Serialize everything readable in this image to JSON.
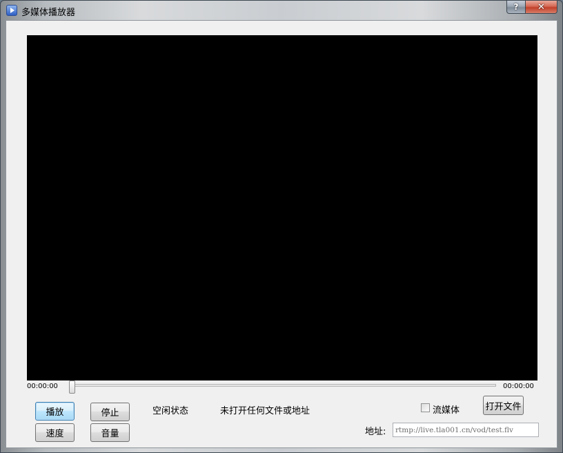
{
  "window": {
    "title": "多媒体播放器",
    "help_label": "?",
    "close_label": "✕"
  },
  "player": {
    "time_current": "00:00:00",
    "time_total": "00:00:00",
    "progress": 0
  },
  "controls": {
    "play_label": "播放",
    "stop_label": "停止",
    "speed_label": "速度",
    "volume_label": "音量",
    "open_file_label": "打开文件"
  },
  "status": {
    "state": "空闲状态",
    "file": "未打开任何文件或地址"
  },
  "stream": {
    "checkbox_label": "流媒体",
    "checked": false
  },
  "address": {
    "label": "地址:",
    "placeholder": "rtmp://live.tla001.cn/vod/test.flv"
  },
  "colors": {
    "video_background": "#000000",
    "client_background": "#f0f0f0",
    "close_button": "#c2402a",
    "default_button_border": "#3c7fb1"
  }
}
